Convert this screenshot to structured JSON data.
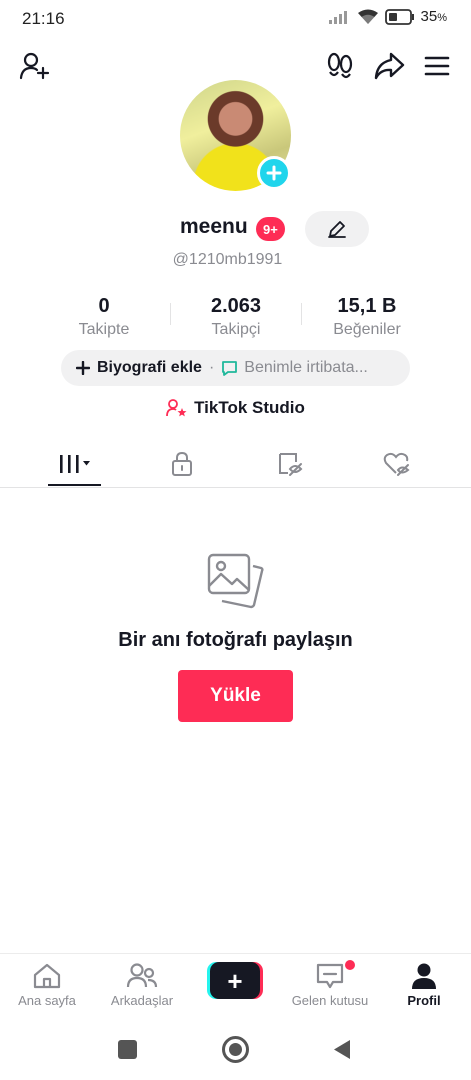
{
  "status_bar": {
    "time": "21:16",
    "battery": "35",
    "battery_unit": "%"
  },
  "profile": {
    "username": "meenu",
    "notification_badge": "9+",
    "handle": "@1210mb1991"
  },
  "stats": [
    {
      "value": "0",
      "label": "Takipte"
    },
    {
      "value": "2.063",
      "label": "Takipçi"
    },
    {
      "value": "15,1 B",
      "label": "Beğeniler"
    }
  ],
  "bio": {
    "add_label": "Biyografi ekle",
    "separator": "·",
    "contact_label": "Benimle irtibata..."
  },
  "studio_label": "TikTok Studio",
  "empty_state": {
    "title": "Bir anı fotoğrafı paylaşın",
    "upload_label": "Yükle"
  },
  "bottom_nav": [
    {
      "label": "Ana sayfa",
      "icon": "home-icon"
    },
    {
      "label": "Arkadaşlar",
      "icon": "friends-icon"
    },
    {
      "label": "",
      "icon": "create-plus-icon"
    },
    {
      "label": "Gelen kutusu",
      "icon": "inbox-icon"
    },
    {
      "label": "Profil",
      "icon": "profile-icon"
    }
  ],
  "colors": {
    "accent": "#fe2c55",
    "cyan": "#25f4ee",
    "text": "#161823",
    "muted": "#8a8b91"
  }
}
